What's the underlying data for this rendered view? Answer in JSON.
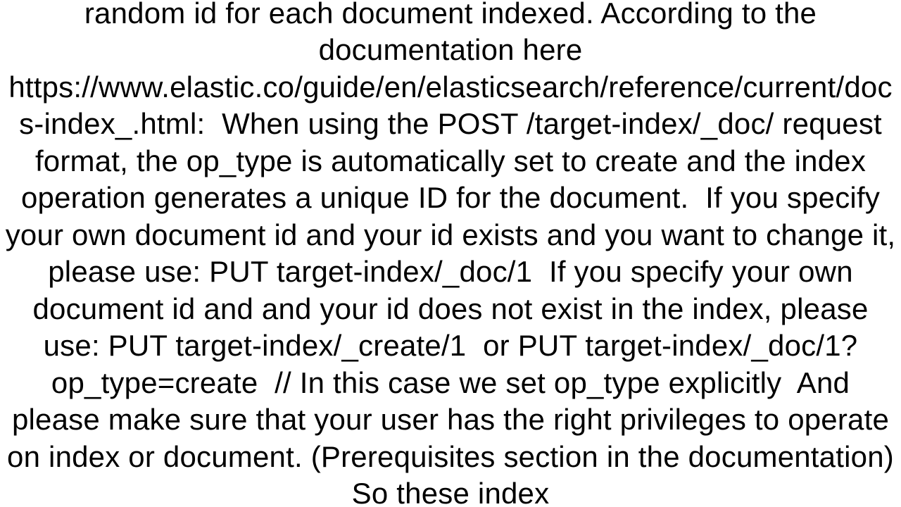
{
  "document": {
    "body_text": "random id for each document indexed. According to the documentation here https://www.elastic.co/guide/en/elasticsearch/reference/current/docs-index_.html:  When using the POST /target-index/_doc/ request format, the op_type is automatically set to create and the index operation generates a unique ID for the document.  If you specify your own document id and your id exists and you want to change it, please use: PUT target-index/_doc/1  If you specify your own document id and and your id does not exist in the index, please use: PUT target-index/_create/1  or PUT target-index/_doc/1?op_type=create  // In this case we set op_type explicitly  And please make sure that your user has the right privileges to operate on index or document. (Prerequisites section in the documentation) So these index"
  }
}
